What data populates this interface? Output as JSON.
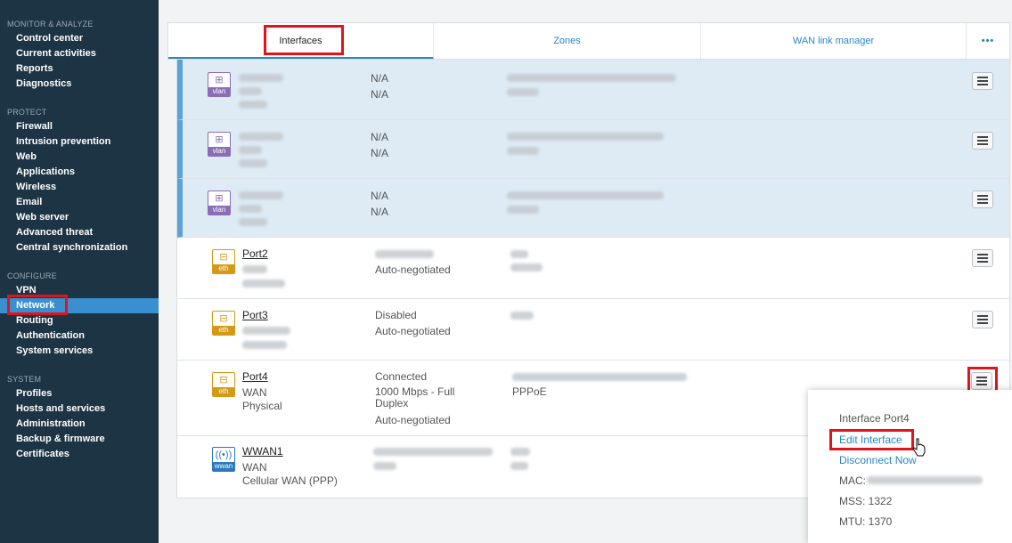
{
  "sidebar": {
    "sections": [
      {
        "title": "MONITOR & ANALYZE",
        "items": [
          "Control center",
          "Current activities",
          "Reports",
          "Diagnostics"
        ]
      },
      {
        "title": "PROTECT",
        "items": [
          "Firewall",
          "Intrusion prevention",
          "Web",
          "Applications",
          "Wireless",
          "Email",
          "Web server",
          "Advanced threat",
          "Central synchronization"
        ]
      },
      {
        "title": "CONFIGURE",
        "items": [
          "VPN",
          "Network",
          "Routing",
          "Authentication",
          "System services"
        ]
      },
      {
        "title": "SYSTEM",
        "items": [
          "Profiles",
          "Hosts and services",
          "Administration",
          "Backup & firmware",
          "Certificates"
        ]
      }
    ],
    "active": "Network"
  },
  "tabs": {
    "interfaces": "Interfaces",
    "zones": "Zones",
    "wan": "WAN link manager",
    "more": "•••"
  },
  "rows": [
    {
      "type": "vlan",
      "status1": "N/A",
      "status2": "N/A"
    },
    {
      "type": "vlan",
      "status1": "N/A",
      "status2": "N/A"
    },
    {
      "type": "vlan",
      "status1": "N/A",
      "status2": "N/A"
    },
    {
      "type": "eth",
      "name": "Port2",
      "status2": "Auto-negotiated"
    },
    {
      "type": "eth",
      "name": "Port3",
      "status1": "Disabled",
      "status2": "Auto-negotiated"
    },
    {
      "type": "eth",
      "name": "Port4",
      "line1": "WAN",
      "line2": "Physical",
      "status1": "Connected",
      "status_speed": "1000 Mbps - Full Duplex",
      "status2": "Auto-negotiated",
      "info2": "PPPoE"
    },
    {
      "type": "wwan",
      "name": "WWAN1",
      "line1": "WAN",
      "line2": "Cellular WAN (PPP)"
    }
  ],
  "badges": {
    "vlan": "vlan",
    "eth": "eth",
    "wwan": "wwan"
  },
  "popup": {
    "title": "Interface Port4",
    "edit": "Edit Interface",
    "disconnect": "Disconnect Now",
    "mac_label": "MAC:",
    "mss": "MSS:  1322",
    "mtu": "MTU:  1370"
  },
  "colors": {
    "sidebar_bg": "#1d3445",
    "active_nav": "#3a8fd0",
    "accent": "#2a86c6",
    "highlight": "#e0141a",
    "vlan": "#8a6db5",
    "eth": "#d49a17",
    "wwan": "#2b78bd"
  }
}
